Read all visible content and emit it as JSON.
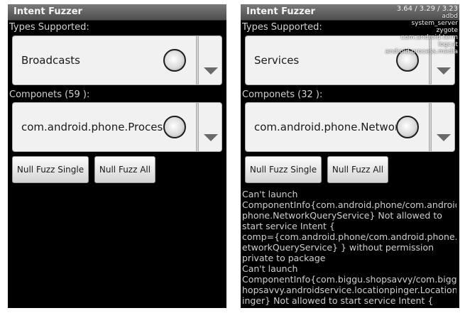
{
  "left": {
    "title": "Intent Fuzzer",
    "types_label": "Types Supported:",
    "types_value": "Broadcasts",
    "components_label": "Componets (59 ):",
    "components_value": "com.android.phone.ProcessO",
    "buttons": {
      "single": "Null Fuzz Single",
      "all": "Null Fuzz All"
    }
  },
  "right": {
    "title": "Intent Fuzzer",
    "types_label": "Types Supported:",
    "types_value": "Services",
    "components_label": "Componets (32 ):",
    "components_value": "com.android.phone.NetworkQ",
    "buttons": {
      "single": "Null Fuzz Single",
      "all": "Null Fuzz All"
    },
    "log": "Can't launch\nComponentInfo{com.android.phone/com.android\nphone.NetworkQueryService} Not allowed to\nstart service Intent {\ncomp={com.android.phone/com.android.phone.N\networkQueryService} } without permission\nprivate to package\nCan't launch\nComponentInfo{com.biggu.shopsavvy/com.biggu.s\nhopsavvy.androidservice.locationpinger.LocationP\ninger} Not allowed to start service Intent {",
    "overlay": {
      "load": "3.64 / 3.29 / 3.23",
      "processes": [
        "adbd",
        "system_server",
        "zygote",
        "com.android.term",
        "logcat",
        "android.process.media"
      ]
    }
  }
}
